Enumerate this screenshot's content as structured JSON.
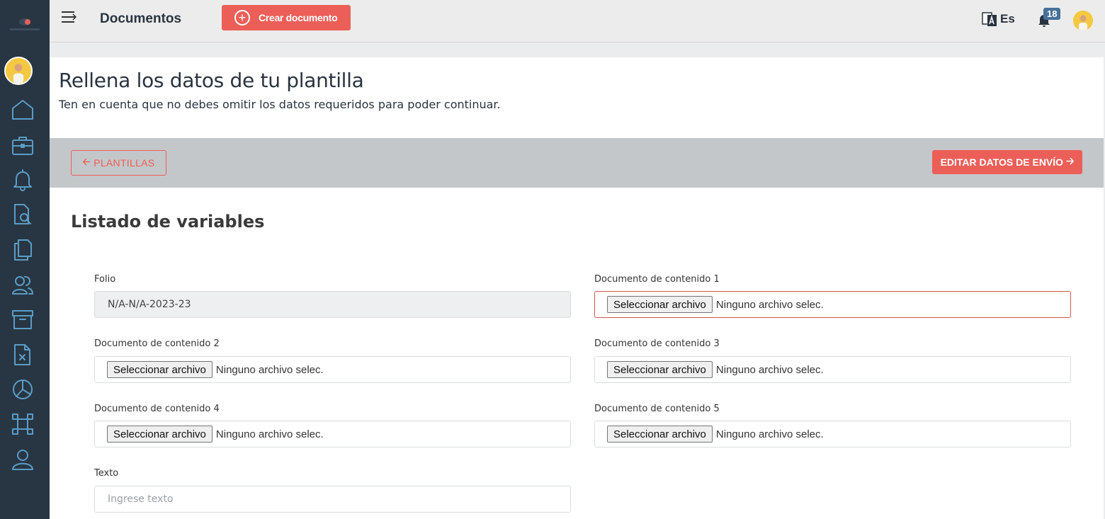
{
  "header": {
    "title": "Documentos",
    "create_button": "Crear documento",
    "language": "Es",
    "notification_count": "18"
  },
  "sidebar": {
    "items": [
      {
        "icon": "home-icon"
      },
      {
        "icon": "briefcase-icon"
      },
      {
        "icon": "bell-icon"
      },
      {
        "icon": "document-search-icon"
      },
      {
        "icon": "copy-documents-icon"
      },
      {
        "icon": "users-icon"
      },
      {
        "icon": "archive-icon"
      },
      {
        "icon": "document-x-icon"
      },
      {
        "icon": "pie-chart-icon"
      },
      {
        "icon": "workflow-icon"
      },
      {
        "icon": "user-icon"
      }
    ]
  },
  "page": {
    "heading": "Rellena los datos de tu plantilla",
    "subheading": "Ten en cuenta que no debes omitir los datos requeridos para poder continuar."
  },
  "toolbar": {
    "back_button": "PLANTILLAS",
    "edit_button": "EDITAR DATOS DE ENVÍO"
  },
  "form": {
    "title": "Listado de variables",
    "folio_label": "Folio",
    "folio_value": "N/A-N/A-2023-23",
    "file_button": "Seleccionar archivo",
    "file_status": "Ninguno archivo selec.",
    "doc1_label": "Documento de contenido 1",
    "doc2_label": "Documento de contenido 2",
    "doc3_label": "Documento de contenido 3",
    "doc4_label": "Documento de contenido 4",
    "doc5_label": "Documento de contenido 5",
    "text_label": "Texto",
    "text_placeholder": "Ingrese texto"
  },
  "colors": {
    "accent": "#ec5f58",
    "sidebar": "#283643",
    "icon": "#5a9cc5",
    "badge": "#45719a"
  }
}
